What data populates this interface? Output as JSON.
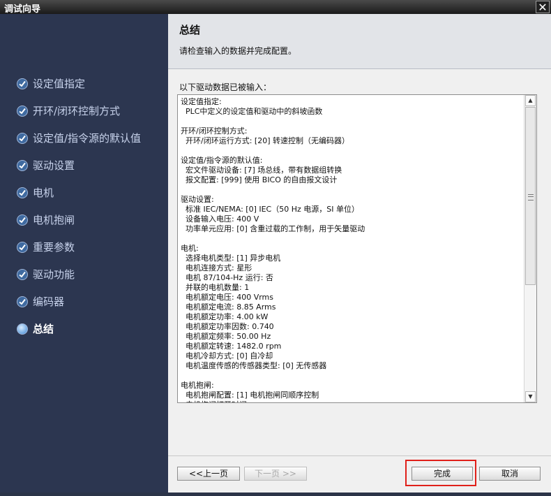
{
  "window": {
    "title": "调试向导",
    "close_icon": "close-icon"
  },
  "sidebar": {
    "items": [
      {
        "label": "设定值指定",
        "icon": "check-icon",
        "state": "done"
      },
      {
        "label": "开环/闭环控制方式",
        "icon": "check-icon",
        "state": "done"
      },
      {
        "label": "设定值/指令源的默认值",
        "icon": "check-icon",
        "state": "done"
      },
      {
        "label": "驱动设置",
        "icon": "check-icon",
        "state": "done"
      },
      {
        "label": "电机",
        "icon": "check-icon",
        "state": "done"
      },
      {
        "label": "电机抱闸",
        "icon": "check-icon",
        "state": "done"
      },
      {
        "label": "重要参数",
        "icon": "check-icon",
        "state": "done"
      },
      {
        "label": "驱动功能",
        "icon": "check-icon",
        "state": "done"
      },
      {
        "label": "编码器",
        "icon": "check-icon",
        "state": "done"
      },
      {
        "label": "总结",
        "icon": "current-step-icon",
        "state": "current"
      }
    ]
  },
  "header": {
    "title": "总结",
    "subtitle": "请检查输入的数据并完成配置。"
  },
  "summary": {
    "intro": "以下驱动数据已被输入：",
    "lines": [
      "设定值指定:",
      "  PLC中定义的设定值和驱动中的斜坡函数",
      "",
      "开环/闭环控制方式:",
      "  开环/闭环运行方式: [20] 转速控制（无编码器）",
      "",
      "设定值/指令源的默认值:",
      "  宏文件驱动设备: [7] 场总线，带有数据组转换",
      "  报文配置: [999] 使用 BICO 的自由报文设计",
      "",
      "驱动设置:",
      "  标准 IEC/NEMA: [0] IEC（50 Hz 电源，SI 单位）",
      "  设备输入电压: 400 V",
      "  功率单元应用: [0] 含重过载的工作制，用于矢量驱动",
      "",
      "电机:",
      "  选择电机类型: [1] 异步电机",
      "  电机连接方式: 星形",
      "  电机 87/104-Hz 运行: 否",
      "  并联的电机数量: 1",
      "  电机额定电压: 400 Vrms",
      "  电机额定电流: 8.85 Arms",
      "  电机额定功率: 4.00 kW",
      "  电机额定功率因数: 0.740",
      "  电机额定频率: 50.00 Hz",
      "  电机额定转速: 1482.0 rpm",
      "  电机冷却方式: [0] 自冷却",
      "  电机温度传感的传感器类型: [0] 无传感器",
      "",
      "电机抱闸:",
      "  电机抱闸配置: [1] 电机抱闸同顺序控制",
      "  电机抱闸打开时间: ..."
    ]
  },
  "scrollbar": {
    "up_icon": "scroll-up-arrow-icon",
    "down_icon": "scroll-down-arrow-icon"
  },
  "buttons": {
    "prev": "<<上一页",
    "next": "下一页 >>",
    "finish": "完成",
    "cancel": "取消"
  }
}
